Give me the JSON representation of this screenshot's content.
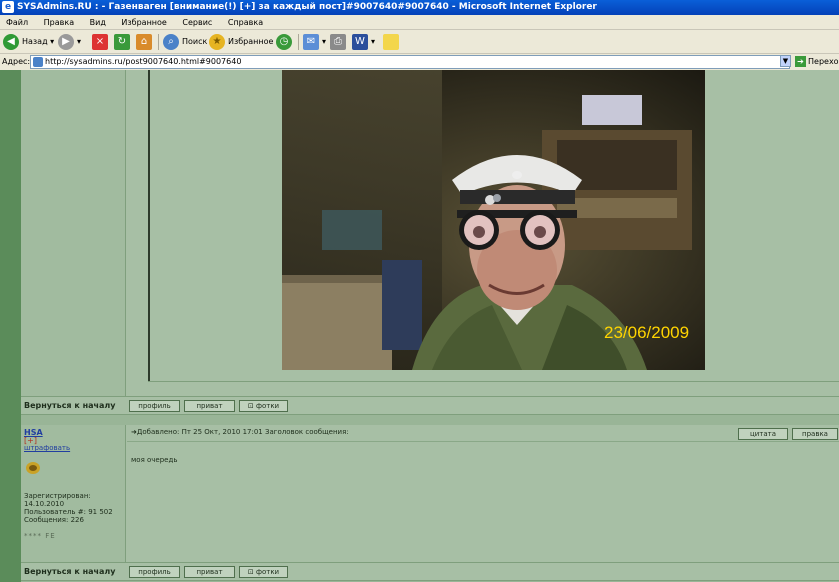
{
  "window": {
    "title": "SYSAdmins.RU : - Газенваген [внимание(!) [+] за каждый пост]#9007640#9007640 - Microsoft Internet Explorer"
  },
  "menu": [
    "Файл",
    "Правка",
    "Вид",
    "Избранное",
    "Сервис",
    "Справка"
  ],
  "toolbar": {
    "back": "Назад",
    "search": "Поиск",
    "favorites": "Избранное"
  },
  "address": {
    "label": "Адрес:",
    "url": "http://sysadmins.ru/post9007640.html#9007640",
    "go": "Переход"
  },
  "photo": {
    "date_stamp": "23/06/2009"
  },
  "post1_footer": {
    "back_to_top": "Вернуться к началу",
    "profile": "профиль",
    "pm": "приват",
    "photos": "фотки"
  },
  "post2": {
    "username": "HSA",
    "status": "[+]",
    "warn": "штрафовать",
    "info_line1": "Зарегистрирован:",
    "info_line2": "14.10.2010",
    "info_line3": "Пользователь #: 91 502",
    "info_line4": "Сообщения: 226",
    "stars": "**** FE",
    "header": "Добавлено: Пт 25 Окт, 2010 17:01    Заголовок сообщения:",
    "body": "моя очередь",
    "quote": "цитата",
    "edit": "правка"
  },
  "post2_footer": {
    "back_to_top": "Вернуться к началу",
    "profile": "профиль",
    "pm": "приват",
    "photos": "фотки"
  }
}
